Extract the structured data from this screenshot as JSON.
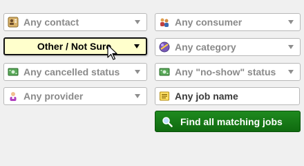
{
  "filters": {
    "contact": {
      "label": "Any contact",
      "icon": "contact-card-icon"
    },
    "consumer": {
      "label": "Any consumer",
      "icon": "consumer-people-icon"
    },
    "type": {
      "label": "Other / Not Sure",
      "icon": "none"
    },
    "category": {
      "label": "Any category",
      "icon": "category-sphere-icon"
    },
    "cancelled_status": {
      "label": "Any cancelled status",
      "icon": "money-status-icon"
    },
    "noshow_status": {
      "label": "Any \"no-show\" status",
      "icon": "money-status-icon"
    },
    "provider": {
      "label": "Any provider",
      "icon": "provider-person-icon"
    },
    "job_name": {
      "placeholder": "Any job name",
      "value": "",
      "icon": "notepad-icon"
    }
  },
  "actions": {
    "find_label": "Find all matching jobs",
    "find_icon": "magnifier-icon"
  },
  "colors": {
    "active_bg": "#ffffcc",
    "button_green": "#137813",
    "muted_text": "#8a8a8a"
  }
}
